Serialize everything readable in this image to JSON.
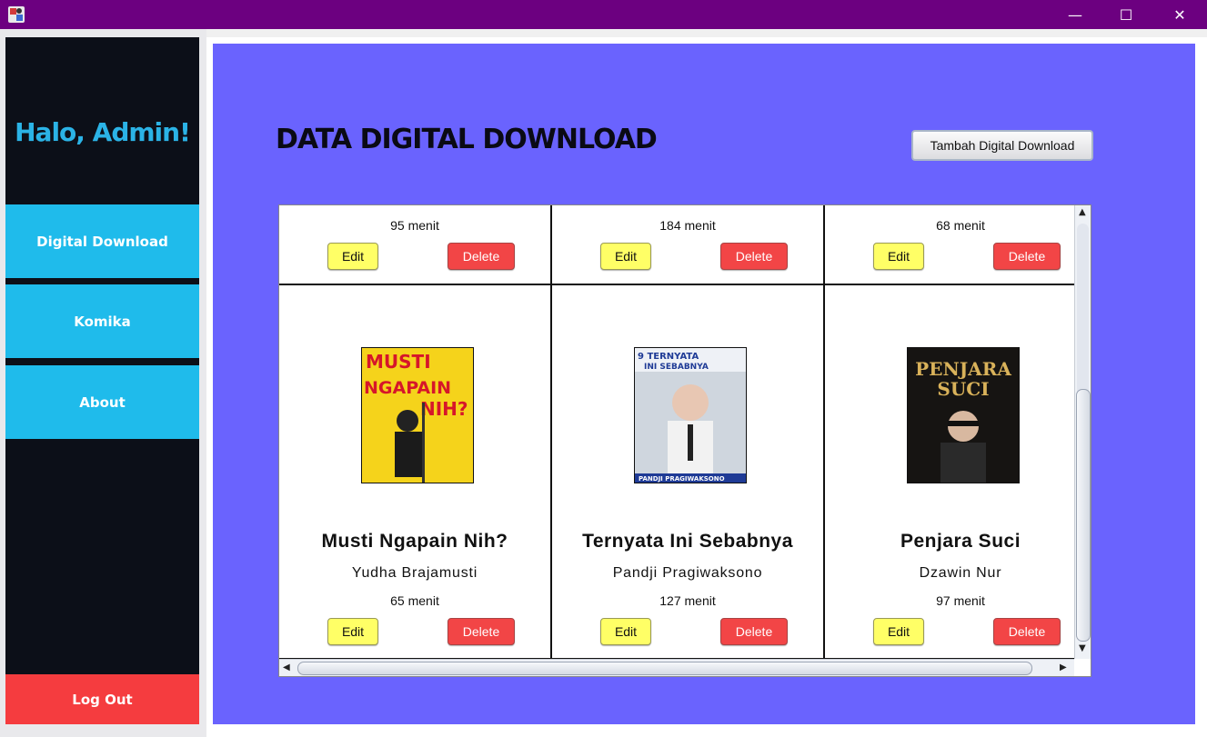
{
  "window": {
    "minimize_glyph": "—",
    "maximize_glyph": "☐",
    "close_glyph": "✕"
  },
  "sidebar": {
    "greeting": "Halo, Admin!",
    "items": [
      {
        "label": "Digital Download"
      },
      {
        "label": "Komika"
      },
      {
        "label": "About"
      }
    ],
    "logout_label": "Log Out"
  },
  "main": {
    "title": "DATA DIGITAL DOWNLOAD",
    "add_button_label": "Tambah Digital Download"
  },
  "top_row": [
    {
      "duration": "95 menit",
      "edit_label": "Edit",
      "delete_label": "Delete"
    },
    {
      "duration": "184 menit",
      "edit_label": "Edit",
      "delete_label": "Delete"
    },
    {
      "duration": "68 menit",
      "edit_label": "Edit",
      "delete_label": "Delete"
    }
  ],
  "cards": [
    {
      "title": "Musti Ngapain Nih?",
      "comic": "Yudha Brajamusti",
      "duration": "65 menit",
      "edit_label": "Edit",
      "delete_label": "Delete",
      "poster": {
        "line1": "MUSTI",
        "line2": "NGAPAIN",
        "line3": "NIH?",
        "bg": "#f5d31b",
        "fg": "#d6162a"
      }
    },
    {
      "title": "Ternyata Ini Sebabnya",
      "comic": "Pandji Pragiwaksono",
      "duration": "127 menit",
      "edit_label": "Edit",
      "delete_label": "Delete",
      "poster": {
        "line1": "9 TERNYATA",
        "line2": "INI SEBABNYA",
        "line3": "PANDJI PRAGIWAKSONO",
        "bg": "#cfd6de",
        "fg": "#1f3b96"
      }
    },
    {
      "title": "Penjara Suci",
      "comic": "Dzawin Nur",
      "duration": "97 menit",
      "edit_label": "Edit",
      "delete_label": "Delete",
      "poster": {
        "line1": "PENJARA",
        "line2": "SUCI",
        "line3": "",
        "bg": "#161412",
        "fg": "#d9b25a"
      }
    }
  ],
  "colors": {
    "titlebar": "#6c0080",
    "sidebar_bg": "#0c0f18",
    "nav_item": "#1fbbeb",
    "logout": "#f53c3f",
    "main_bg": "#6a63fe",
    "edit_btn": "#ffff66",
    "delete_btn": "#f24546"
  }
}
